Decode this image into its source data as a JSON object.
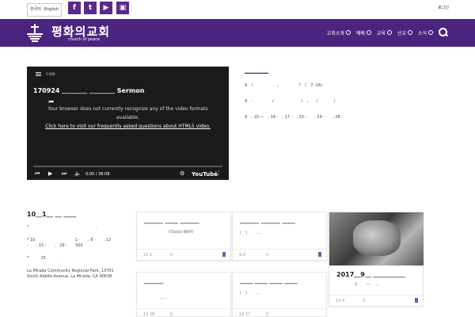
{
  "topbar": {
    "lang_flag": "한국어",
    "lang_label": "English",
    "social": [
      "f",
      "t",
      "▶",
      "▣"
    ],
    "right_link": "로그인"
  },
  "header": {
    "logo_ko": "평화의교회",
    "logo_en": "church of peace",
    "nav": [
      "교회소개",
      "예배",
      "교육",
      "선교",
      "소식"
    ]
  },
  "video": {
    "quality": "1:000",
    "title": "170924 ＿＿＿＿ ＿＿＿＿ Sermon",
    "message_line1": "Your browser does not currently recognize any of the video formats available.",
    "message_link": "Click here to visit our frequently asked questions about HTML5 video.",
    "time": "0:00 / 38:08",
    "brand": "YouTube"
  },
  "info": {
    "heading": "＿＿＿＿＿",
    "p1": "9　（　　　　　　，　　　　　？（　7: 16)",
    "p2": "9　:　　　　　/　　　　　　　/　，　　/　　　　/",
    "p3": "9　: 10 —　, 14 -　, 17 -　, 23 -　　, 24 -　　, 28 -"
  },
  "bleft": {
    "heading": "10＿1＿ ＿ ＿＿",
    "p1": "*　　　　　　　　　　　　　　　　　.",
    "p2": "* 10　　　　　　　　　　1 -　　, 8 -　　, 12 -　　, 15 -　　,　29 -　　500　　.",
    "p3": "*　　　15　　　.",
    "p4": "La Mirada Community Regional Park, 13701 South Adelfa Avenue, La Mirada, CA 90638"
  },
  "cards": [
    {
      "title": "＿＿＿ ＿＿ ＿＿＿",
      "sub": "(Ousta Wolf)",
      "views": "10 1",
      "comments": "0"
    },
    {
      "title": "＿＿＿ ＿＿＿ ＿＿",
      "sub": "(　)　　.....",
      "views": "9 9",
      "comments": "0"
    },
    {
      "title": "2017＿9＿ ＿＿＿＿＿",
      "sub": "1.　　—　...",
      "views": "10 4",
      "comments": "0"
    },
    {
      "title": "＿＿＿",
      "sub": "　　　　.....",
      "views": "10 28",
      "comments": "0"
    },
    {
      "title": "＿＿ ＿＿ ＿＿ ＿＿",
      "sub": "(　)　　.....",
      "views": "10 27",
      "comments": "0"
    }
  ],
  "colors": {
    "brand_purple": "#4b2480"
  }
}
